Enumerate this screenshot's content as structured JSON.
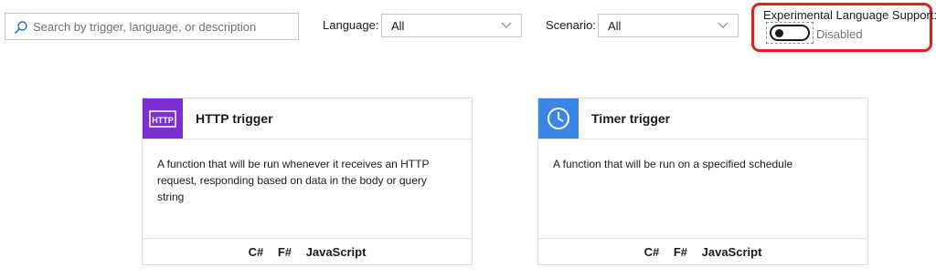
{
  "search": {
    "placeholder": "Search by trigger, language, or description",
    "icon": "search-icon"
  },
  "filters": {
    "language": {
      "label": "Language:",
      "selected": "All"
    },
    "scenario": {
      "label": "Scenario:",
      "selected": "All"
    }
  },
  "experimental": {
    "title": "Experimental Language Support:",
    "state": "Disabled",
    "enabled": false,
    "highlight_color": "#e02020"
  },
  "cards": [
    {
      "title": "HTTP trigger",
      "icon_text": "HTTP",
      "icon": "http-icon",
      "tile_color": "#7b2fd1",
      "description": "A function that will be run whenever it receives an HTTP request, responding based on data in the body or query string",
      "languages": [
        "C#",
        "F#",
        "JavaScript"
      ]
    },
    {
      "title": "Timer trigger",
      "icon": "clock-icon",
      "tile_color": "#3a86e8",
      "description": "A function that will be run on a specified schedule",
      "languages": [
        "C#",
        "F#",
        "JavaScript"
      ]
    }
  ]
}
